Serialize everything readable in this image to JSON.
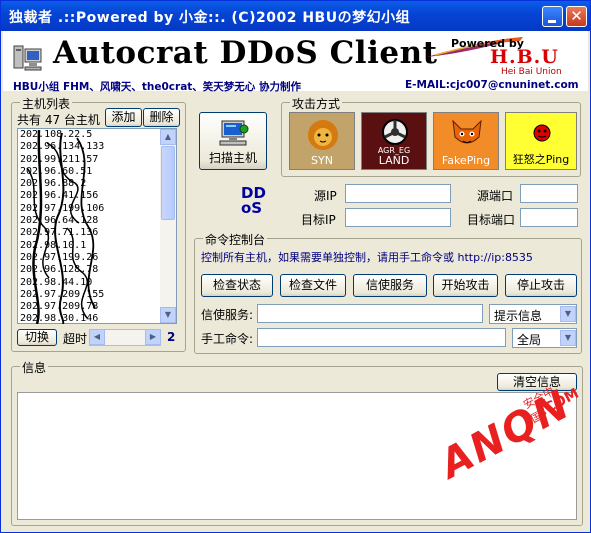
{
  "titlebar": {
    "title": "独裁者 .::Powered by 小金::. (C)2002 HBUの梦幻小组",
    "minimize_symbol": "",
    "close_symbol": "✕"
  },
  "banner": {
    "app_title": "Autocrat DDoS Client",
    "powered_by": "Powered by",
    "hbu": "H.B.U",
    "hbu_sub": "Hei Bai Union",
    "credits": "HBU小组 FHM、风啸天、the0crat、笑天梦无心 协力制作",
    "email": "E-MAIL:cjc007@cnuninet.com"
  },
  "host_panel": {
    "group_label": "主机列表",
    "count_text": "共有 47 台主机",
    "add_label": "添加",
    "delete_label": "删除",
    "hosts": [
      "202.108.22.5",
      "202.96.134.133",
      "202.99.211.57",
      "202.96.60.51",
      "202.96.88.2",
      "202.96.41.156",
      "202.97.199.106",
      "202.96.64.128",
      "202.97.71.136",
      "202.98.10.1",
      "202.97.199.26",
      "202.96.128.78",
      "202.98.44.10",
      "202.97.209.155",
      "202.97.209.78",
      "202.98.30.146",
      "202.97.21.196"
    ],
    "switch_label": "切换",
    "timeout_label": "超时",
    "timeout_value": "2"
  },
  "scan": {
    "label": "扫描主机"
  },
  "attack": {
    "group_label": "攻击方式",
    "methods": [
      {
        "label": "SYN",
        "icon": "lion-icon",
        "bg": "#c2a46a"
      },
      {
        "label": "LAND",
        "icon": "steering-wheel-icon",
        "top_text": "AGR_EG",
        "bg": "#5a1010"
      },
      {
        "label": "FakePing",
        "icon": "fox-icon",
        "bg": "#f28c28"
      },
      {
        "label": "狂怒之Ping",
        "icon": "ladybug-icon",
        "bg": "#ffff33"
      }
    ]
  },
  "ddos_logo": {
    "line1": "DD",
    "line2": "oS"
  },
  "addresses": {
    "src_ip_label": "源IP",
    "src_port_label": "源端口",
    "dst_ip_label": "目标IP",
    "dst_port_label": "目标端口",
    "src_ip": "",
    "src_port": "",
    "dst_ip": "",
    "dst_port": ""
  },
  "command": {
    "group_label": "命令控制台",
    "hint": "控制所有主机，如果需要单独控制，请用手工命令或 http://ip:8535",
    "buttons": [
      "检查状态",
      "检查文件",
      "信使服务",
      "开始攻击",
      "停止攻击"
    ],
    "messenger_label": "信使服务:",
    "messenger_value": "",
    "messenger_select": "提示信息",
    "manual_label": "手工命令:",
    "manual_value": "",
    "manual_select": "全局"
  },
  "info": {
    "group_label": "信息",
    "clear_label": "清空信息",
    "content": ""
  },
  "watermark": {
    "main": "ANQN",
    "cn": "安全中国",
    "com": ".COM"
  },
  "colors": {
    "titlebar": "#0745d6",
    "hint_text": "#000080",
    "watermark": "#e82020"
  }
}
